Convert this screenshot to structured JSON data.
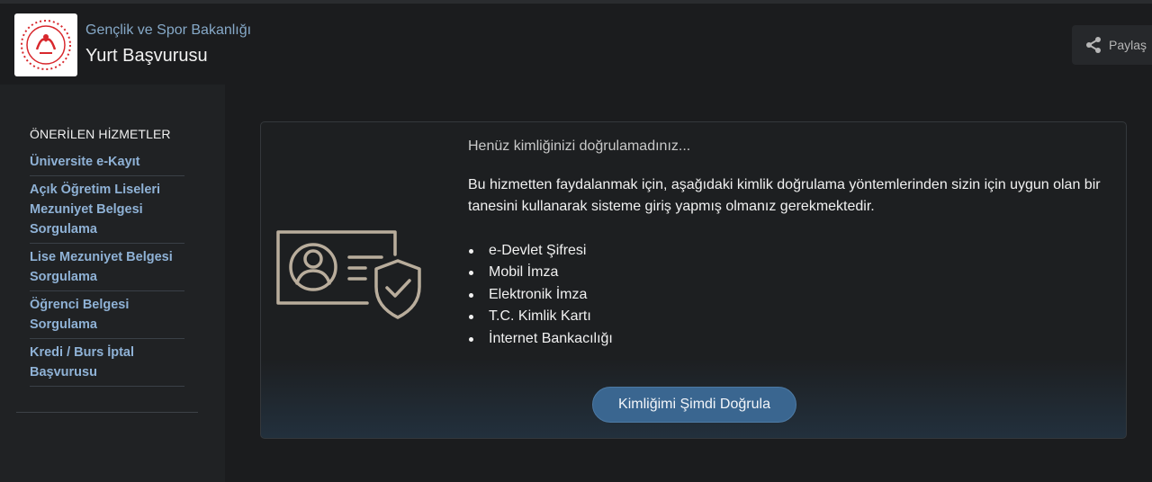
{
  "header": {
    "org_name": "Gençlik ve Spor Bakanlığı",
    "service_title": "Yurt Başvurusu",
    "share_label": "Paylaş",
    "logo_icon": "ministry-logo-icon"
  },
  "sidebar": {
    "heading": "ÖNERİLEN HİZMETLER",
    "items": [
      {
        "label": "Üniversite e-Kayıt"
      },
      {
        "label": "Açık Öğretim Liseleri Mezuniyet Belgesi Sorgulama"
      },
      {
        "label": "Lise Mezuniyet Belgesi Sorgulama"
      },
      {
        "label": "Öğrenci Belgesi Sorgulama"
      },
      {
        "label": "Kredi / Burs İptal Başvurusu"
      }
    ]
  },
  "main": {
    "notice_title": "Henüz kimliğinizi doğrulamadınız...",
    "notice_text": "Bu hizmetten faydalanmak için, aşağıdaki kimlik doğrulama yöntemlerinden sizin için uygun olan bir tanesini kullanarak sisteme giriş yapmış olmanız gerekmektedir.",
    "methods": [
      "e-Devlet Şifresi",
      "Mobil İmza",
      "Elektronik İmza",
      "T.C. Kimlik Kartı",
      "İnternet Bankacılığı"
    ],
    "verify_button_label": "Kimliğimi Şimdi Doğrula",
    "illustration_icon": "id-card-shield-icon"
  },
  "colors": {
    "background": "#1b1c1e",
    "link": "#8fb2d6",
    "button": "#3a6690",
    "illustration": "#b9ad9c"
  }
}
